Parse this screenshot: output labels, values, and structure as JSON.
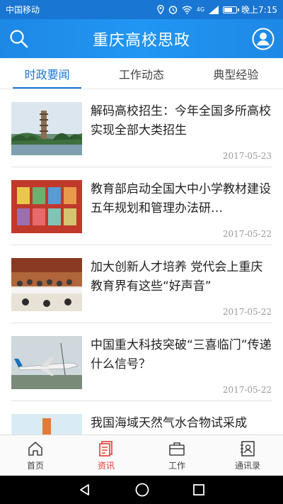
{
  "status_bar": {
    "carrier": "中国移动",
    "network": "4G",
    "time": "晚上7:15",
    "battery_level": 0.7
  },
  "header": {
    "title": "重庆高校思政",
    "search_icon": "search-icon",
    "user_icon": "user-icon"
  },
  "tabs": [
    {
      "label": "时政要闻",
      "active": true
    },
    {
      "label": "工作动态",
      "active": false
    },
    {
      "label": "典型经验",
      "active": false
    }
  ],
  "news": [
    {
      "title": "解码高校招生：今年全国多所高校实现全部大类招生",
      "date": "2017-05-23",
      "thumb": "pagoda-lake-photo"
    },
    {
      "title": "教育部启动全国大中小学教材建设五年规划和管理办法研…",
      "date": "2017-05-22",
      "thumb": "textbooks-photo"
    },
    {
      "title": "加大创新人才培养 党代会上重庆教育界有这些“好声音”",
      "date": "2017-05-22",
      "thumb": "meeting-photo"
    },
    {
      "title": "中国重大科技突破“三喜临门”传递什么信号？",
      "date": "2017-05-22",
      "thumb": "airplane-photo"
    },
    {
      "title": "我国海域天然气水合物试采成",
      "date": "",
      "thumb": "gas-drilling-illustration"
    }
  ],
  "bottom_nav": [
    {
      "label": "首页",
      "icon": "home-icon",
      "active": false
    },
    {
      "label": "资讯",
      "icon": "news-icon",
      "active": true
    },
    {
      "label": "工作",
      "icon": "briefcase-icon",
      "active": false
    },
    {
      "label": "通讯录",
      "icon": "contacts-icon",
      "active": false
    }
  ],
  "colors": {
    "primary": "#1976d2",
    "active_nav": "#e53935"
  }
}
